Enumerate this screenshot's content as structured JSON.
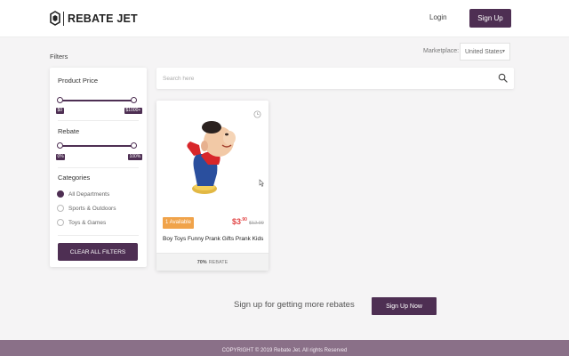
{
  "header": {
    "brand": "REBATE JET",
    "login_label": "Login",
    "signup_label": "Sign Up"
  },
  "filters": {
    "title": "Filters",
    "price": {
      "heading": "Product Price",
      "min_tag": "$0",
      "max_tag": "$1000+"
    },
    "rebate": {
      "heading": "Rebate",
      "min_tag": "0%",
      "max_tag": "100%"
    },
    "categories": {
      "heading": "Categories",
      "items": [
        {
          "label": "All Departments",
          "checked": true
        },
        {
          "label": "Sports & Outdoors",
          "checked": false
        },
        {
          "label": "Toys & Games",
          "checked": false
        }
      ]
    },
    "clear_label": "CLEAR ALL FILTERS"
  },
  "marketplace": {
    "label": "Marketplace:",
    "selected": "United States"
  },
  "search": {
    "placeholder": "Search here",
    "value": ""
  },
  "product": {
    "availability": "1 Available",
    "price_whole": "$3",
    "price_cents": ".90",
    "old_price": "$12.99",
    "title": "Boy Toys Funny Prank Gifts Prank Kids",
    "rebate_percent": "70%",
    "rebate_label": "REBATE"
  },
  "cta": {
    "text": "Sign up for getting more rebates",
    "button_label": "Sign Up Now"
  },
  "footer": {
    "copyright": "COPYRIGHT © 2019 Rebate Jet. All rights Reserved"
  },
  "colors": {
    "brand": "#4e2f53",
    "footer": "#8a7088",
    "availability": "#f0a34a",
    "price": "#e14545"
  },
  "icons": [
    "logo-hexagon-icon",
    "search-icon",
    "clock-icon",
    "caret-down-icon",
    "cursor-icon"
  ]
}
